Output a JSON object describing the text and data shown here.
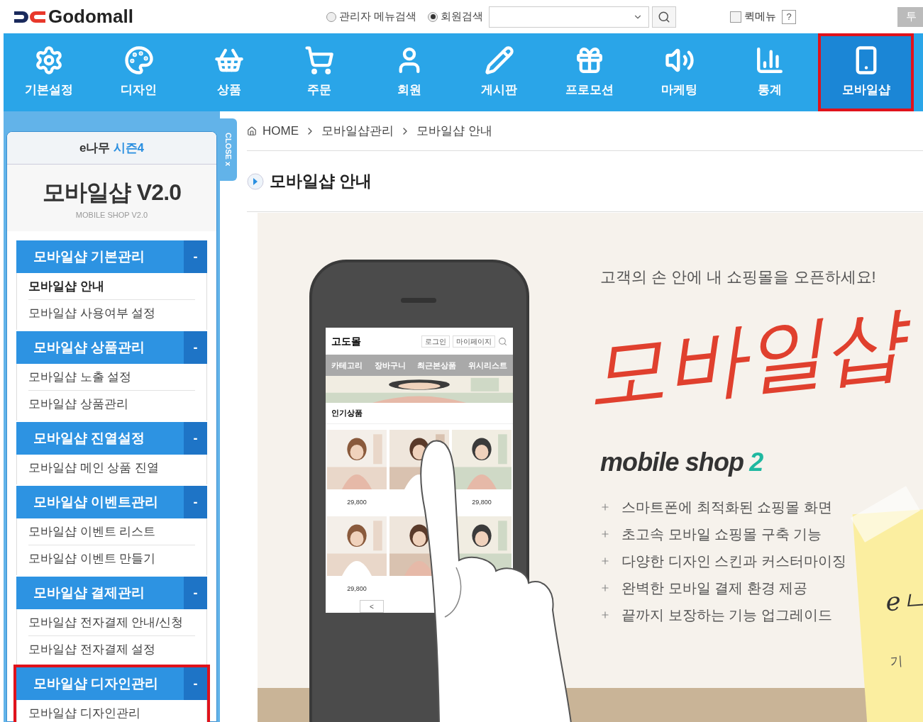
{
  "header": {
    "logo": "Godomall",
    "search_modes": [
      {
        "label": "관리자 메뉴검색",
        "selected": false
      },
      {
        "label": "회원검색",
        "selected": true
      }
    ],
    "quick_menu": {
      "label": "퀵메뉴",
      "checked": false
    },
    "help": "?",
    "edge_button": "투"
  },
  "nav": [
    {
      "label": "기본설정",
      "selected": false
    },
    {
      "label": "디자인",
      "selected": false
    },
    {
      "label": "상품",
      "selected": false
    },
    {
      "label": "주문",
      "selected": false
    },
    {
      "label": "회원",
      "selected": false
    },
    {
      "label": "게시판",
      "selected": false
    },
    {
      "label": "프로모션",
      "selected": false
    },
    {
      "label": "마케팅",
      "selected": false
    },
    {
      "label": "통계",
      "selected": false
    },
    {
      "label": "모바일샵",
      "selected": true
    }
  ],
  "sidebar": {
    "brand": "e나무",
    "season": "시즌4",
    "title": "모바일샵 V2.0",
    "subtitle": "MOBILE SHOP V2.0",
    "close": "CLOSE x",
    "groups": [
      {
        "title": "모바일샵 기본관리",
        "toggle": "-",
        "highlighted": false,
        "items": [
          {
            "label": "모바일샵 안내",
            "selected": true
          },
          {
            "label": "모바일샵 사용여부 설정",
            "selected": false
          }
        ]
      },
      {
        "title": "모바일샵 상품관리",
        "toggle": "-",
        "highlighted": false,
        "items": [
          {
            "label": "모바일샵 노출 설정",
            "selected": false
          },
          {
            "label": "모바일샵 상품관리",
            "selected": false
          }
        ]
      },
      {
        "title": "모바일샵 진열설정",
        "toggle": "-",
        "highlighted": false,
        "items": [
          {
            "label": "모바일샵 메인 상품 진열",
            "selected": false
          }
        ]
      },
      {
        "title": "모바일샵 이벤트관리",
        "toggle": "-",
        "highlighted": false,
        "items": [
          {
            "label": "모바일샵 이벤트 리스트",
            "selected": false
          },
          {
            "label": "모바일샵 이벤트 만들기",
            "selected": false
          }
        ]
      },
      {
        "title": "모바일샵 결제관리",
        "toggle": "-",
        "highlighted": false,
        "items": [
          {
            "label": "모바일샵 전자결제 안내/신청",
            "selected": false
          },
          {
            "label": "모바일샵 전자결제 설정",
            "selected": false
          }
        ]
      },
      {
        "title": "모바일샵 디자인관리",
        "toggle": "-",
        "highlighted": true,
        "items": [
          {
            "label": "모바일샵 디자인관리",
            "selected": false
          }
        ]
      }
    ]
  },
  "breadcrumb": [
    "HOME",
    "모바일샵관리",
    "모바일샵 안내"
  ],
  "page_title": "모바일샵 안내",
  "banner": {
    "tagline": "고객의 손 안에 내 쇼핑몰을 오픈하세요!",
    "script_title": "모바일샵",
    "product": "mobile shop",
    "version": "2",
    "features": [
      "스마트폰에 최적화된 쇼핑몰 화면",
      "초고속 모바일 쇼핑몰 구축 기능",
      "다양한 디자인 스킨과 커스터마이징",
      "완벽한 모바일 결제 환경 제공",
      "끝까지 보장하는 기능 업그레이드"
    ],
    "phone": {
      "shop_name": "고도몰",
      "buttons": [
        "로그인",
        "마이페이지"
      ],
      "menu": [
        "카테고리",
        "장바구니",
        "최근본상품",
        "위시리스트"
      ],
      "section": "인기상품",
      "products": [
        {
          "kind": "picture",
          "price": "29,800"
        },
        {
          "kind": "picture"
        },
        {
          "kind": "picture",
          "price": "29,800"
        },
        {
          "kind": "picture",
          "price": "29,800"
        },
        {
          "kind": "picture"
        },
        {
          "kind": "picture"
        }
      ],
      "pager": "<"
    },
    "note": [
      "eㄴ",
      "기"
    ]
  }
}
